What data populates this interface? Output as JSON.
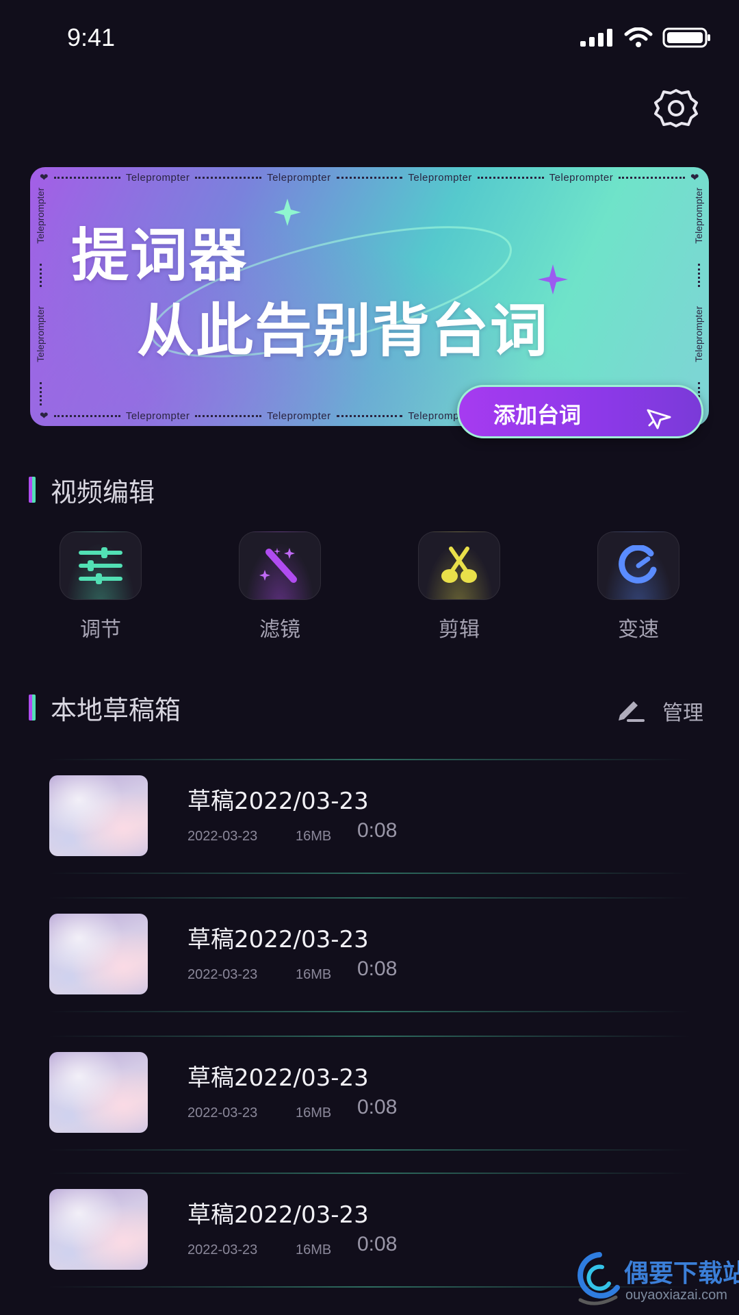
{
  "status_bar": {
    "time": "9:41"
  },
  "banner": {
    "brand": "Teleprompter",
    "title_line1": "提词器",
    "title_line2": "从此告别背台词",
    "cta_label": "添加台词"
  },
  "video_edit": {
    "title": "视频编辑",
    "tools": [
      {
        "label": "调节",
        "icon": "sliders-icon",
        "accent": "#52e0b4"
      },
      {
        "label": "滤镜",
        "icon": "magic-wand-icon",
        "accent": "#b04cf0"
      },
      {
        "label": "剪辑",
        "icon": "scissors-icon",
        "accent": "#e9e04a"
      },
      {
        "label": "变速",
        "icon": "speed-gauge-icon",
        "accent": "#5a8cff"
      }
    ]
  },
  "drafts": {
    "title": "本地草稿箱",
    "manage_label": "管理",
    "items": [
      {
        "title": "草稿2022/03-23",
        "date": "2022-03-23",
        "size": "16MB",
        "duration": "0:08"
      },
      {
        "title": "草稿2022/03-23",
        "date": "2022-03-23",
        "size": "16MB",
        "duration": "0:08"
      },
      {
        "title": "草稿2022/03-23",
        "date": "2022-03-23",
        "size": "16MB",
        "duration": "0:08"
      },
      {
        "title": "草稿2022/03-23",
        "date": "2022-03-23",
        "size": "16MB",
        "duration": "0:08"
      }
    ]
  },
  "watermark": {
    "name": "偶要下载站",
    "url": "ouyaoxiazai.com"
  },
  "colors": {
    "background": "#110e1b",
    "accent_purple": "#b04cf0",
    "accent_green": "#52e0b4"
  }
}
